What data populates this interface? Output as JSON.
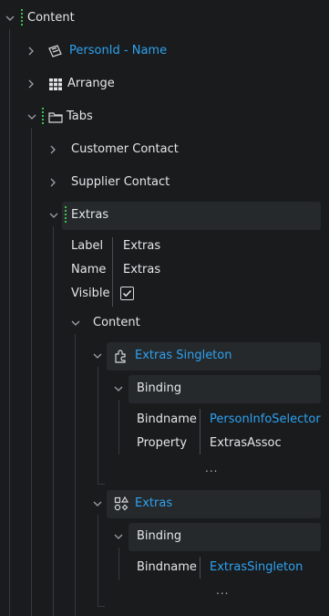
{
  "tree": {
    "root": {
      "label": "Content"
    },
    "person": {
      "label": "PersonId - Name"
    },
    "arrange": {
      "label": "Arrange"
    },
    "tabs": {
      "label": "Tabs"
    },
    "customer_contact": {
      "label": "Customer Contact"
    },
    "supplier_contact": {
      "label": "Supplier Contact"
    },
    "extras_tab": {
      "label": "Extras",
      "properties": [
        {
          "key": "Label",
          "value": "Extras"
        },
        {
          "key": "Name",
          "value": "Extras"
        },
        {
          "key": "Visible",
          "value": "checked"
        }
      ]
    },
    "inner_content": {
      "label": "Content"
    },
    "extras_singleton": {
      "label": "Extras Singleton",
      "binding_label": "Binding",
      "bindname_key": "Bindname",
      "bindname_value": "PersonInfoSelector",
      "property_key": "Property",
      "property_value": "ExtrasAssoc",
      "more": "..."
    },
    "extras_item": {
      "label": "Extras",
      "binding_label": "Binding",
      "bindname_key": "Bindname",
      "bindname_value": "ExtrasSingleton",
      "more": "..."
    }
  },
  "colors": {
    "background": "#191b1d",
    "link": "#2fa2f0",
    "grip": "#3fbf4f",
    "highlight": "#25292c",
    "guide": "#363a3e"
  },
  "icons": {
    "expanded": "chevron-down-icon",
    "collapsed": "chevron-right-icon",
    "person": "id-card-icon",
    "arrange": "grid-icon",
    "tabs": "tabs-icon",
    "singleton": "puzzle-icon",
    "item": "shapes-icon"
  }
}
